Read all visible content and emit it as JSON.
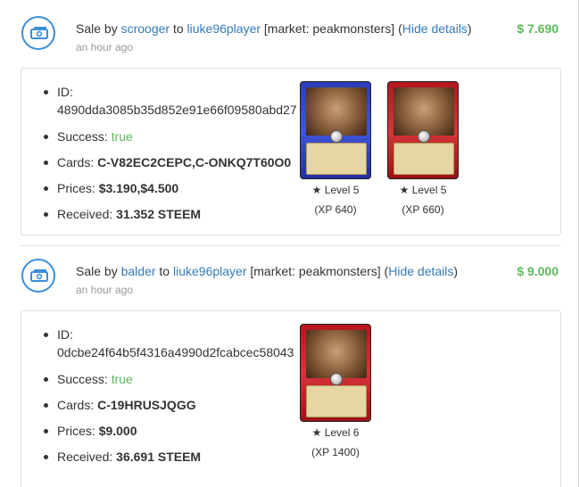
{
  "labels": {
    "sale_by": "Sale by",
    "to": "to",
    "hide_details": "Hide details",
    "id": "ID:",
    "success": "Success:",
    "cards": "Cards:",
    "prices": "Prices:",
    "received": "Received:"
  },
  "sales": [
    {
      "seller": "scrooger",
      "buyer": "liuke96player",
      "market": "[market: peakmonsters]",
      "time": "an hour ago",
      "amount": "$ 7.690",
      "id": "4890dda3085b35d852e91e66f09580abd27",
      "success": "true",
      "cards": "C-V82EC2CEPC,C-ONKQ7T60O0",
      "prices": "$3.190,$4.500",
      "received": "31.352 STEEM",
      "card_items": [
        {
          "level": "Level 5",
          "xp": "(XP 640)",
          "color": "#2c3cb8"
        },
        {
          "level": "Level 5",
          "xp": "(XP 660)",
          "color": "#c0181e"
        }
      ]
    },
    {
      "seller": "balder",
      "buyer": "liuke96player",
      "market": "[market: peakmonsters]",
      "time": "an hour ago",
      "amount": "$ 9.000",
      "id": "0dcbe24f64b5f4316a4990d2fcabcec58043",
      "success": "true",
      "cards": "C-19HRUSJQGG",
      "prices": "$9.000",
      "received": "36.691 STEEM",
      "card_items": [
        {
          "level": "Level 6",
          "xp": "(XP 1400)",
          "color": "#c0181e"
        }
      ]
    }
  ],
  "colors": {
    "link": "#337ab7",
    "amount": "#5cb85c",
    "success": "#5cb85c",
    "icon_ring": "#3b8fd9"
  },
  "icons": {
    "sale": "money-stack-icon",
    "level": "star-icon"
  }
}
